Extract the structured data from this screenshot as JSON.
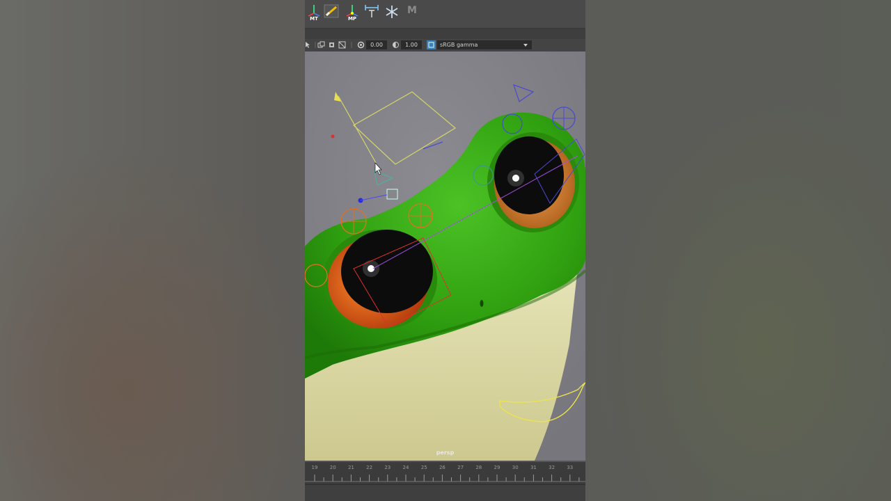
{
  "shelf": {
    "items": [
      {
        "label": "MT",
        "icon": "move-tool-icon"
      },
      {
        "label": "",
        "icon": "brush-icon"
      },
      {
        "label": "MP",
        "icon": "move-pivot-icon"
      },
      {
        "label": "",
        "icon": "measure-icon"
      },
      {
        "label": "",
        "icon": "asterisk-icon"
      },
      {
        "label": "M",
        "icon": "maya-logo-icon"
      }
    ]
  },
  "view_toolbar": {
    "exposure": "0.00",
    "gamma": "1.00",
    "color_space": "sRGB gamma"
  },
  "viewport": {
    "camera": "persp"
  },
  "timeline": {
    "frames": [
      "19",
      "20",
      "21",
      "22",
      "23",
      "24",
      "25",
      "26",
      "27",
      "28",
      "29",
      "30",
      "31",
      "32",
      "33"
    ]
  }
}
